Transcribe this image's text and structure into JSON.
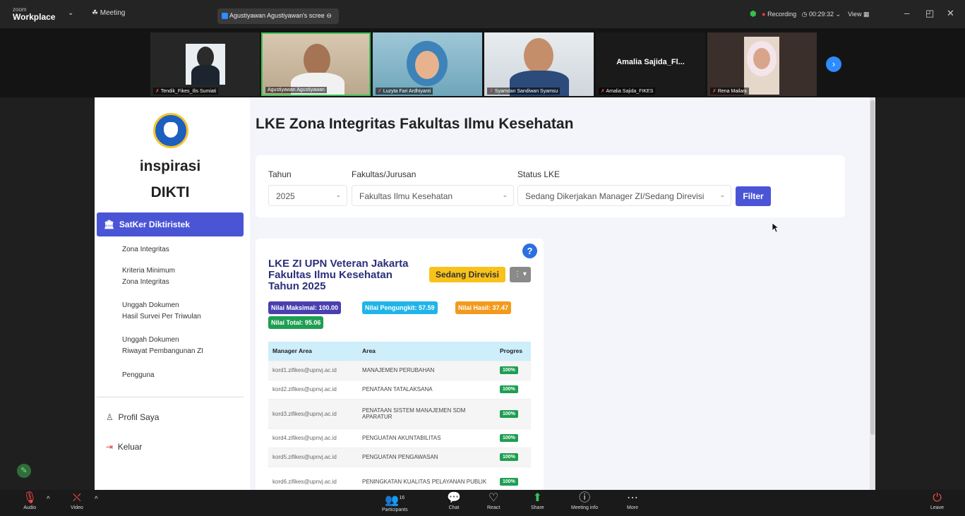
{
  "zoom": {
    "logo_top": "zoom",
    "logo_bottom": "Workplace",
    "menu_meeting": "Meeting",
    "share_tab": "Agustiyawan Agustiyawan's scree",
    "recording": "Recording",
    "timer": "00:29:32",
    "view": "View"
  },
  "participants": [
    {
      "name": "Tendik_Fikes_Ilis Sumiati"
    },
    {
      "name": "Agustiyawan Agustiyawan"
    },
    {
      "name": "Luzyta Fari Ardhiyanti"
    },
    {
      "name": "Syamdan Sandiwan Syamsu"
    },
    {
      "name": "Amalia Sajida_FIKES",
      "display": "Amalia Sajida_Fl..."
    },
    {
      "name": "Rena Mailani"
    }
  ],
  "sidebar": {
    "brand_line1": "inspirasi",
    "brand_line2": "DIKTI",
    "active_item": "SatKer Diktiristek",
    "sub_items": [
      {
        "l1": "Zona Integritas",
        "l2": ""
      },
      {
        "l1": "Kriteria Minimum",
        "l2": "Zona Integritas"
      },
      {
        "l1": "Unggah Dokumen",
        "l2": "Hasil Survei Per Triwulan"
      },
      {
        "l1": "Unggah Dokumen",
        "l2": "Riwayat Pembangunan ZI"
      },
      {
        "l1": "Pengguna",
        "l2": ""
      }
    ],
    "profile": "Profil Saya",
    "logout": "Keluar"
  },
  "main": {
    "title": "LKE Zona Integritas Fakultas Ilmu Kesehatan",
    "filters": {
      "year_label": "Tahun",
      "year_value": "2025",
      "faculty_label": "Fakultas/Jurusan",
      "faculty_value": "Fakultas Ilmu Kesehatan",
      "status_label": "Status LKE",
      "status_value": "Sedang Dikerjakan Manager ZI/Sedang Direvisi",
      "filter_button": "Filter"
    },
    "card": {
      "help": "?",
      "title_l1": "LKE ZI UPN Veteran Jakarta",
      "title_l2": "Fakultas Ilmu Kesehatan",
      "title_l3": "Tahun 2025",
      "status": "Sedang Direvisi",
      "pills": {
        "max": "Nilai Maksimal: 100.00",
        "pengungkit": "Nilai Pengungkit: 57.59",
        "hasil": "Nilai Hasil: 37.47",
        "total": "Nilai Total: 95.06"
      },
      "columns": [
        "Manager Area",
        "Area",
        "Progres"
      ],
      "rows": [
        {
          "manager": "kord1.zifikes@upnvj.ac.id",
          "area": "MANAJEMEN PERUBAHAN",
          "progress": "100%"
        },
        {
          "manager": "kord2.zifikes@upnvj.ac.id",
          "area": "PENATAAN TATALAKSANA",
          "progress": "100%"
        },
        {
          "manager": "kord3.zifikes@upnvj.ac.id",
          "area": "PENATAAN SISTEM MANAJEMEN SDM APARATUR",
          "progress": "100%"
        },
        {
          "manager": "kord4.zifikes@upnvj.ac.id",
          "area": "PENGUATAN AKUNTABILITAS",
          "progress": "100%"
        },
        {
          "manager": "kord5.zifikes@upnvj.ac.id",
          "area": "PENGUATAN PENGAWASAN",
          "progress": "100%"
        },
        {
          "manager": "kord6.zifikes@upnvj.ac.id",
          "area": "PENINGKATAN KUALITAS PELAYANAN PUBLIK",
          "progress": "100%"
        }
      ]
    }
  },
  "toolbar": {
    "audio": "Audio",
    "video": "Video",
    "participants": "Participants",
    "participants_count": "16",
    "chat": "Chat",
    "react": "React",
    "share": "Share",
    "meeting_info": "Meeting info",
    "more": "More",
    "leave": "Leave"
  },
  "colors": {
    "accent": "#4a55d6",
    "status_yellow": "#f8c21a",
    "progress_green": "#1e9e52",
    "pill_max": "#4a3fb0",
    "pill_pengungkit": "#1fb5e8",
    "pill_hasil": "#f29a1e",
    "pill_total": "#1e9e52"
  }
}
